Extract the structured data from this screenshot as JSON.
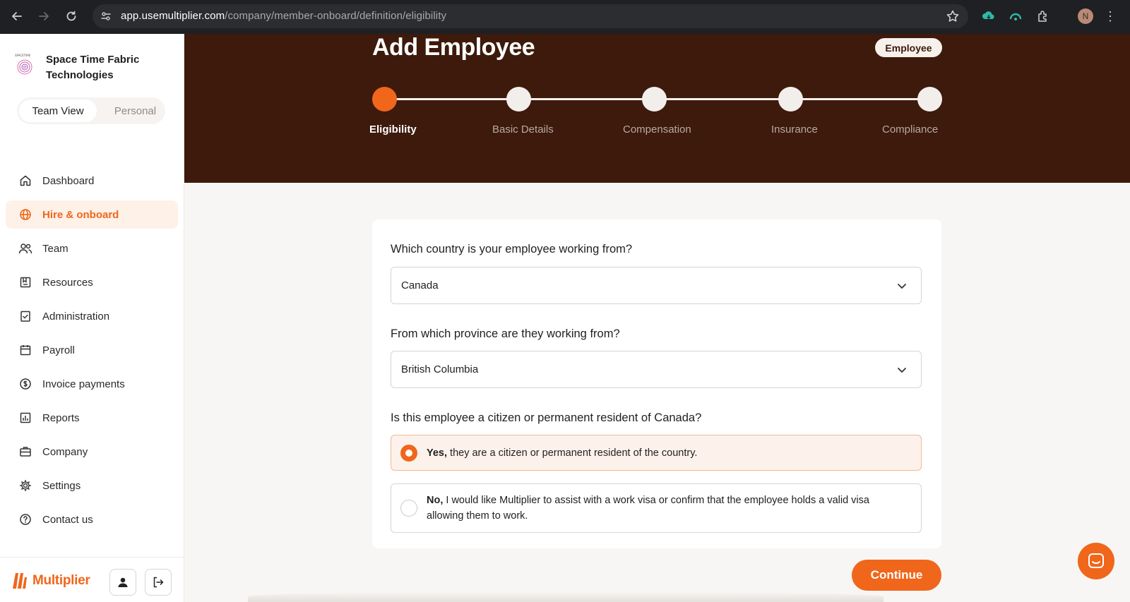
{
  "browser": {
    "url_host": "app.usemultiplier.com",
    "url_path": "/company/member-onboard/definition/eligibility",
    "profile_initial": "N"
  },
  "sidebar": {
    "company_name": "Space Time Fabric Technologies",
    "logo_caption": "SPACETIME",
    "view_toggle": {
      "active": "Team View",
      "inactive": "Personal"
    },
    "items": [
      {
        "label": "Dashboard",
        "icon": "home-icon"
      },
      {
        "label": "Hire & onboard",
        "icon": "globe-icon",
        "active": true
      },
      {
        "label": "Team",
        "icon": "people-icon"
      },
      {
        "label": "Resources",
        "icon": "resources-icon"
      },
      {
        "label": "Administration",
        "icon": "clipboard-check-icon"
      },
      {
        "label": "Payroll",
        "icon": "calendar-icon"
      },
      {
        "label": "Invoice payments",
        "icon": "dollar-icon"
      },
      {
        "label": "Reports",
        "icon": "chart-icon"
      },
      {
        "label": "Company",
        "icon": "briefcase-icon"
      },
      {
        "label": "Settings",
        "icon": "gear-icon"
      },
      {
        "label": "Contact us",
        "icon": "help-icon"
      }
    ],
    "brand": "Multiplier"
  },
  "header": {
    "title": "Add Employee",
    "badge": "Employee",
    "steps": [
      {
        "label": "Eligibility",
        "current": true
      },
      {
        "label": "Basic Details"
      },
      {
        "label": "Compensation"
      },
      {
        "label": "Insurance"
      },
      {
        "label": "Compliance"
      }
    ]
  },
  "form": {
    "country_question": "Which country is your employee working from?",
    "country_value": "Canada",
    "province_question": "From which province are they working from?",
    "province_value": "British Columbia",
    "citizen_question": "Is this employee a citizen or permanent resident of Canada?",
    "option_yes_bold": "Yes,",
    "option_yes_text": " they are a citizen or permanent resident of the country.",
    "option_no_bold": "No,",
    "option_no_text": " I would like Multiplier to assist with a work visa or confirm that the employee holds a valid visa allowing them to work.",
    "selected_option": "yes"
  },
  "actions": {
    "continue_label": "Continue"
  },
  "colors": {
    "accent": "#f0661b",
    "hero_bg": "#3d1a0b"
  }
}
